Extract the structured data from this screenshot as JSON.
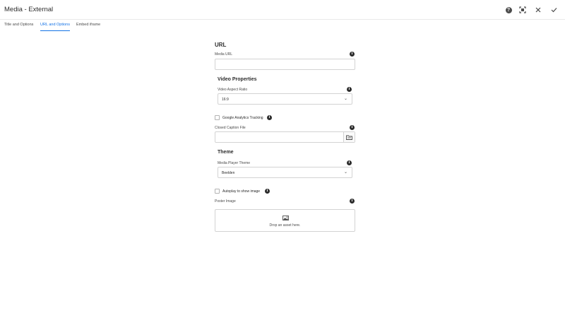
{
  "window": {
    "title": "Media - External",
    "icons": [
      "help-icon",
      "fullscreen-icon",
      "close-icon",
      "done-checkmark-icon"
    ]
  },
  "tabs": [
    {
      "label": "Title and Options",
      "active": false
    },
    {
      "label": "URL and Options",
      "active": true
    },
    {
      "label": "Embed iframe",
      "active": false
    }
  ],
  "url_section": {
    "heading": "URL",
    "media_url": {
      "label": "Media URL",
      "value": "",
      "placeholder": ""
    }
  },
  "video_properties": {
    "heading": "Video Properties",
    "aspect_ratio": {
      "label": "Video Aspect Ratio",
      "selected": "16:9"
    }
  },
  "tracking": {
    "google_analytics": {
      "label": "Google Analytics Tracking",
      "checked": false
    },
    "closed_caption": {
      "label": "Closed Caption File",
      "value": ""
    }
  },
  "theme": {
    "heading": "Theme",
    "media_player_theme": {
      "label": "Media Player Theme",
      "selected": "Beelden"
    }
  },
  "autoplay": {
    "label": "Autoplay to show image",
    "checked": false
  },
  "poster": {
    "label": "Poster Image",
    "drop_text": "Drop an asset here."
  },
  "info_glyph": "i"
}
